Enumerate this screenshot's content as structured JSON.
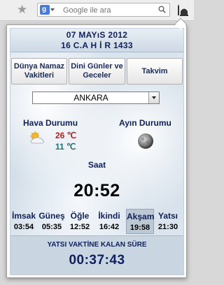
{
  "browser": {
    "search_placeholder": "Google ile ara",
    "engine_letter": "g",
    "star_icon": "star-icon",
    "addon_icon": "mosque-icon"
  },
  "date": {
    "gregorian": "07 MAYıS 2012",
    "hijri": "16 C.A H İ R 1433"
  },
  "buttons": {
    "prayer_times": "Dünya Namaz Vakitleri",
    "religious_days": "Dini Günler ve Geceler",
    "calendar": "Takvim"
  },
  "city": {
    "selected": "ANKARA"
  },
  "weather": {
    "title": "Hava Durumu",
    "icon": "partly-cloudy-icon",
    "high": "26 ℃",
    "low": "11 ℃"
  },
  "moon": {
    "title": "Ayın Durumu",
    "icon": "full-moon-icon"
  },
  "clock": {
    "label": "Saat",
    "time": "20:52"
  },
  "prayers": [
    {
      "name": "İmsak",
      "time": "03:54"
    },
    {
      "name": "Güneş",
      "time": "05:35"
    },
    {
      "name": "Öğle",
      "time": "12:52"
    },
    {
      "name": "İkindi",
      "time": "16:42"
    },
    {
      "name": "Akşam",
      "time": "19:58",
      "active": true
    },
    {
      "name": "Yatsı",
      "time": "21:30"
    }
  ],
  "remaining": {
    "label": "YATSI VAKTİNE KALAN SÜRE",
    "time": "00:37:43"
  },
  "colors": {
    "accent": "#10205a",
    "temp_high": "#b02020",
    "temp_low": "#207070",
    "active_prayer": "#bcc8d4"
  }
}
